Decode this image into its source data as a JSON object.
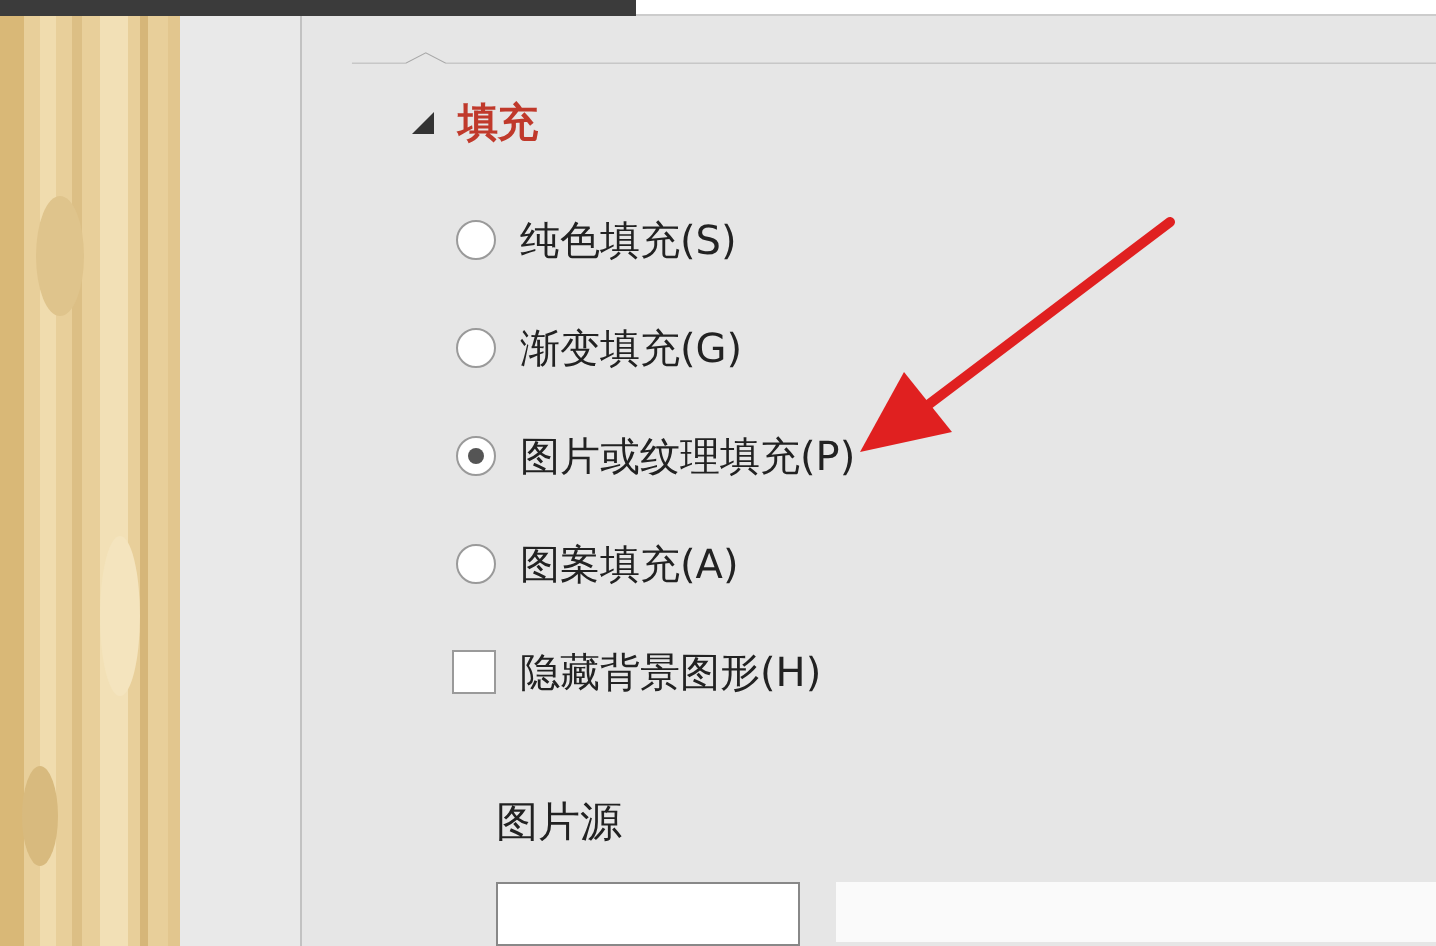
{
  "section": {
    "title": "填充",
    "expanded": true
  },
  "fill_options": [
    {
      "kind": "radio",
      "label": "纯色填充(S)",
      "selected": false
    },
    {
      "kind": "radio",
      "label": "渐变填充(G)",
      "selected": false
    },
    {
      "kind": "radio",
      "label": "图片或纹理填充(P)",
      "selected": true
    },
    {
      "kind": "radio",
      "label": "图案填充(A)",
      "selected": false
    },
    {
      "kind": "checkbox",
      "label": "隐藏背景图形(H)",
      "checked": false
    }
  ],
  "picture_source": {
    "label": "图片源"
  }
}
